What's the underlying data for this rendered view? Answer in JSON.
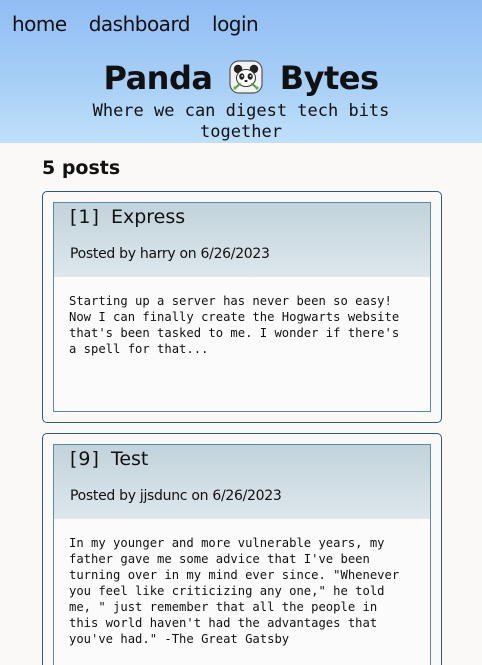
{
  "nav": {
    "items": [
      {
        "label": "home"
      },
      {
        "label": "dashboard"
      },
      {
        "label": "login"
      }
    ]
  },
  "brand": {
    "name_left": "Panda",
    "name_right": "Bytes",
    "logo_icon": "panda-icon",
    "tagline": "Where we can digest tech bits together"
  },
  "feed": {
    "count_label": "5 posts",
    "posts": [
      {
        "id": "[1]",
        "title": "Express",
        "posted_by_prefix": "Posted by",
        "author": "harry",
        "on_word": "on",
        "date": "6/26/2023",
        "body": "Starting up a server has never been so easy!\nNow I can finally create the Hogwarts website\nthat's been tasked to me. I wonder if there's\na spell for that..."
      },
      {
        "id": "[9]",
        "title": "Test",
        "posted_by_prefix": "Posted by",
        "author": "jjsdunc",
        "on_word": "on",
        "date": "6/26/2023",
        "body": "In my younger and more vulnerable years, my\nfather gave me some advice that I've been\nturning over in my mind ever since. \"Whenever\nyou feel like criticizing any one,\" he told\nme, \" just remember that all the people in\nthis world haven't had the advantages that\nyou've had.\" -The Great Gatsby"
      }
    ]
  },
  "colors": {
    "header_top": "#91bdf4",
    "header_bottom": "#bfe0fa",
    "card_border": "#2d5c7a",
    "card_header": "#c2d3db",
    "page_background": "#faf9f7"
  }
}
